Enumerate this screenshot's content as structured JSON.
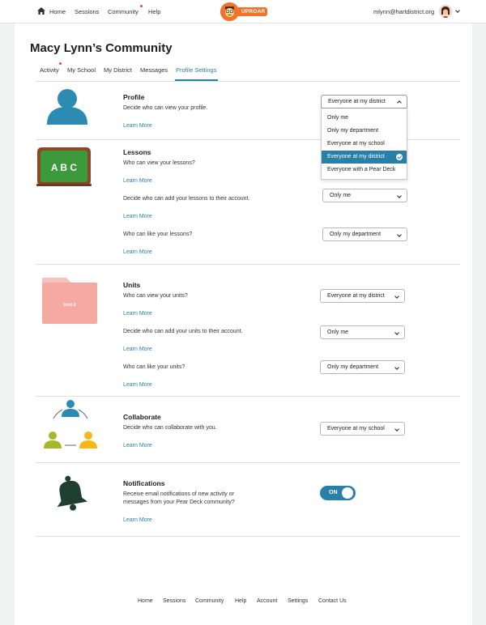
{
  "nav": {
    "home": "Home",
    "sessions": "Sessions",
    "community": "Community",
    "help": "Help",
    "logo_text": "UPROAR",
    "email": "mlynn@hartdistrict.org"
  },
  "page_title": "Macy Lynn’s Community",
  "tabs": [
    "Activity",
    "My School",
    "My District",
    "Messages",
    "Profile Settings"
  ],
  "active_tab": "Profile Settings",
  "sections": {
    "profile": {
      "title": "Profile",
      "description": "Decide who can view your profile.",
      "link": "Learn More",
      "select": "Everyone at my district",
      "options": [
        "Only me",
        "Only my department",
        "Everyone at my school",
        "Everyone at my district",
        "Everyone with a Pear Deck"
      ],
      "selected_option": "Everyone at my district"
    },
    "lessons": {
      "title": "Lessons",
      "icon_text": "A B C",
      "rows": [
        {
          "description": "Who can view your lessons?",
          "link": "Learn More"
        },
        {
          "description": "Decide who can add your lessons to their account.",
          "link": "Learn More",
          "select": "Only me"
        },
        {
          "description": "Who can like your lessons?",
          "link": "Learn More",
          "select": "Only my department"
        }
      ]
    },
    "units": {
      "title": "Units",
      "icon_text": "Unit 2",
      "rows": [
        {
          "description": "Who can view your units?",
          "link": "Learn More",
          "select": "Everyone at my district"
        },
        {
          "description": "Decide who can add your units to their account.",
          "link": "Learn More",
          "select": "Only me"
        },
        {
          "description": "Who can like your units?",
          "link": "Learn More",
          "select": "Only my department"
        }
      ]
    },
    "collaborate": {
      "title": "Collaborate",
      "description": "Decide who can collaborate with you.",
      "link": "Learn More",
      "select": "Everyone at my school"
    },
    "notifications": {
      "title": "Notifications",
      "description_line1": "Receive email notifications of new activity or",
      "description_line2": "messages from your Pear Deck community?",
      "link": "Learn More",
      "toggle": "ON",
      "enabled": true
    }
  },
  "footer": [
    "Home",
    "Sessions",
    "Community",
    "Help",
    "Account",
    "Settings",
    "Contact Us"
  ],
  "colors": {
    "accent": "#2a7fa8",
    "chalkboard": "#3d9a3a",
    "chalkboard_frame": "#8a4a2a",
    "folder": "#f4aaa3",
    "bell": "#1f3f33",
    "badge": "#e04747",
    "logo": "#f0732a"
  },
  "icons": [
    "home-icon",
    "avatar",
    "chevron-down-icon",
    "chevron-up-icon",
    "check-icon",
    "person-icon",
    "chalkboard-icon",
    "folder-icon",
    "collaborate-icon",
    "bell-icon"
  ]
}
